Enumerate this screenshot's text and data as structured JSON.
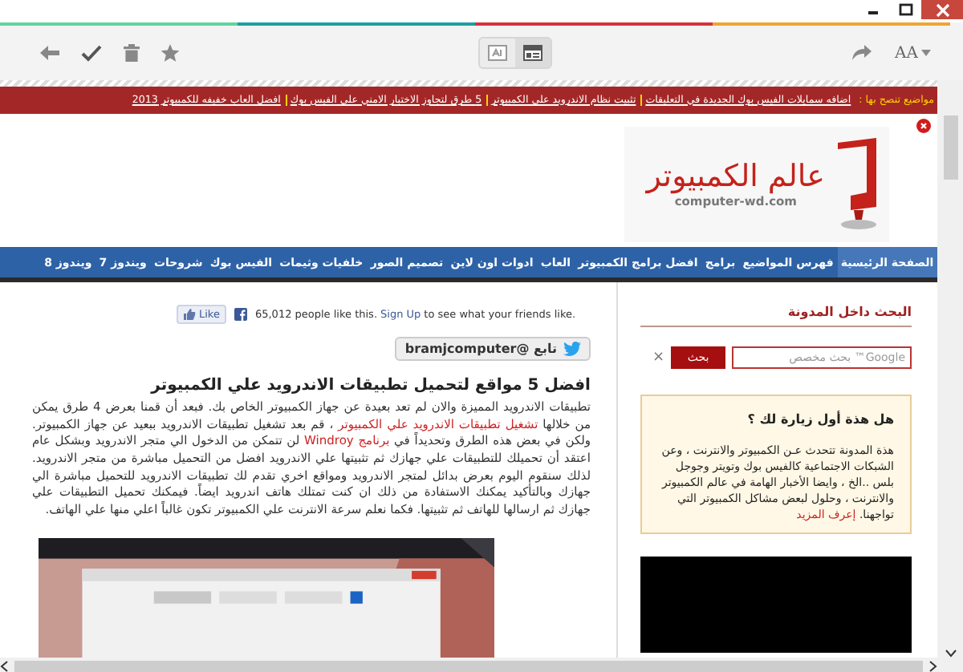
{
  "toolbar": {
    "view_modes": [
      {
        "kind": "reader",
        "selected": false
      },
      {
        "kind": "layout",
        "selected": true
      }
    ],
    "text_size_label": "AA"
  },
  "ticker": {
    "label": "مواضيع تنصح بها :",
    "items": [
      "اضافه سمايلات الفيس بوك الجديدة في التعليقات",
      "تثبيت نظام الاندرويد على الكمبيوتر",
      "5 طرق لتجاوز الاختبار الامني على الفيس بوك",
      "افضل العاب خفيفه للكمبيوتر 2013"
    ]
  },
  "header": {
    "logo_title": "عالم الكمبيوتر",
    "logo_domain": "computer-wd.com"
  },
  "nav": [
    {
      "label": "الصفحة الرئيسية",
      "selected": true
    },
    {
      "label": "فهرس المواضيع",
      "selected": false
    },
    {
      "label": "برامج",
      "selected": false
    },
    {
      "label": "افضل برامج الكمبيوتر",
      "selected": false
    },
    {
      "label": "العاب",
      "selected": false
    },
    {
      "label": "ادوات اون لاين",
      "selected": false
    },
    {
      "label": "تصميم الصور",
      "selected": false
    },
    {
      "label": "خلفيات وثيمات",
      "selected": false
    },
    {
      "label": "الفيس بوك",
      "selected": false
    },
    {
      "label": "شروحات",
      "selected": false
    },
    {
      "label": "ويندوز 7",
      "selected": false
    },
    {
      "label": "ويندوز 8",
      "selected": false
    }
  ],
  "article": {
    "like_button": "Like",
    "like_count": "65,012 people like this.",
    "sign_up_link": "Sign Up",
    "like_hint": "to see what your friends like.",
    "follow_button": "تابع @bramjcomputer",
    "title": "افضل 5 مواقع لتحميل تطبيقات الاندرويد علي الكمبيوتر",
    "paragraph": [
      {
        "text": "تطبيقات الاندرويد المميزة والان لم تعد بعيدة عن جهاز الكمبيوتر الخاص بك. فبعد أن قمنا بعرض 4 طرق يمكن من خلالها "
      },
      {
        "link": "تشغيل تطبيقات الاندرويد علي الكمبيوتر"
      },
      {
        "text": " ، قم بعد تشغيل تطبيقات الاندرويد ببعيد عن جهاز الكمبيوتر. ولكن في بعض هذه الطرق وتحديداً في "
      },
      {
        "link": "برنامج Windroy"
      },
      {
        "text": " لن تتمكن من الدخول الي متجر الاندرويد وبشكل عام اعتقد أن تحميلك للتطبيقات علي جهازك ثم تثبيتها علي الاندرويد افضل من التحميل مباشرة من متجر الاندرويد. لذلك سنقوم اليوم بعرض بدائل لمتجر الاندرويد ومواقع اخري تقدم لك تطبيقات الاندرويد للتحميل مباشرة الي جهازك وبالتأكيد يمكنك الاستفادة من ذلك ان كنت تمتلك هاتف اندرويد ايضاً. فيمكنك تحميل التطبيقات علي جهازك ثم ارسالها للهاتف ثم تثبيتها. فكما نعلم سرعة الانترنت علي الكمبيوتر تكون غالباً اعلي منها علي الهاتف."
      }
    ]
  },
  "sidebar": {
    "search_heading": "البحث داخل المدونة",
    "search": {
      "placeholder": "Google™ بحث مخصص",
      "button": "بحث",
      "clear": "×"
    },
    "welcome": {
      "title": "هل هذة أول زيارة لك ؟",
      "text": [
        {
          "text": "هذة المدونة تتحدث عـن الكمبيوتر والانترنت ، وعن الشبكات الاجتماعية كالفيس بوك وتويتر وجوجل بلس ..الخ ، وايضا الأخبار الهامة في عالم الكمبيوتر والانترنت ، وحلول لبعض مشاكل الكمبيوتر التي تواجهنا. "
        },
        {
          "link": "إعرف المزيد"
        }
      ]
    }
  }
}
